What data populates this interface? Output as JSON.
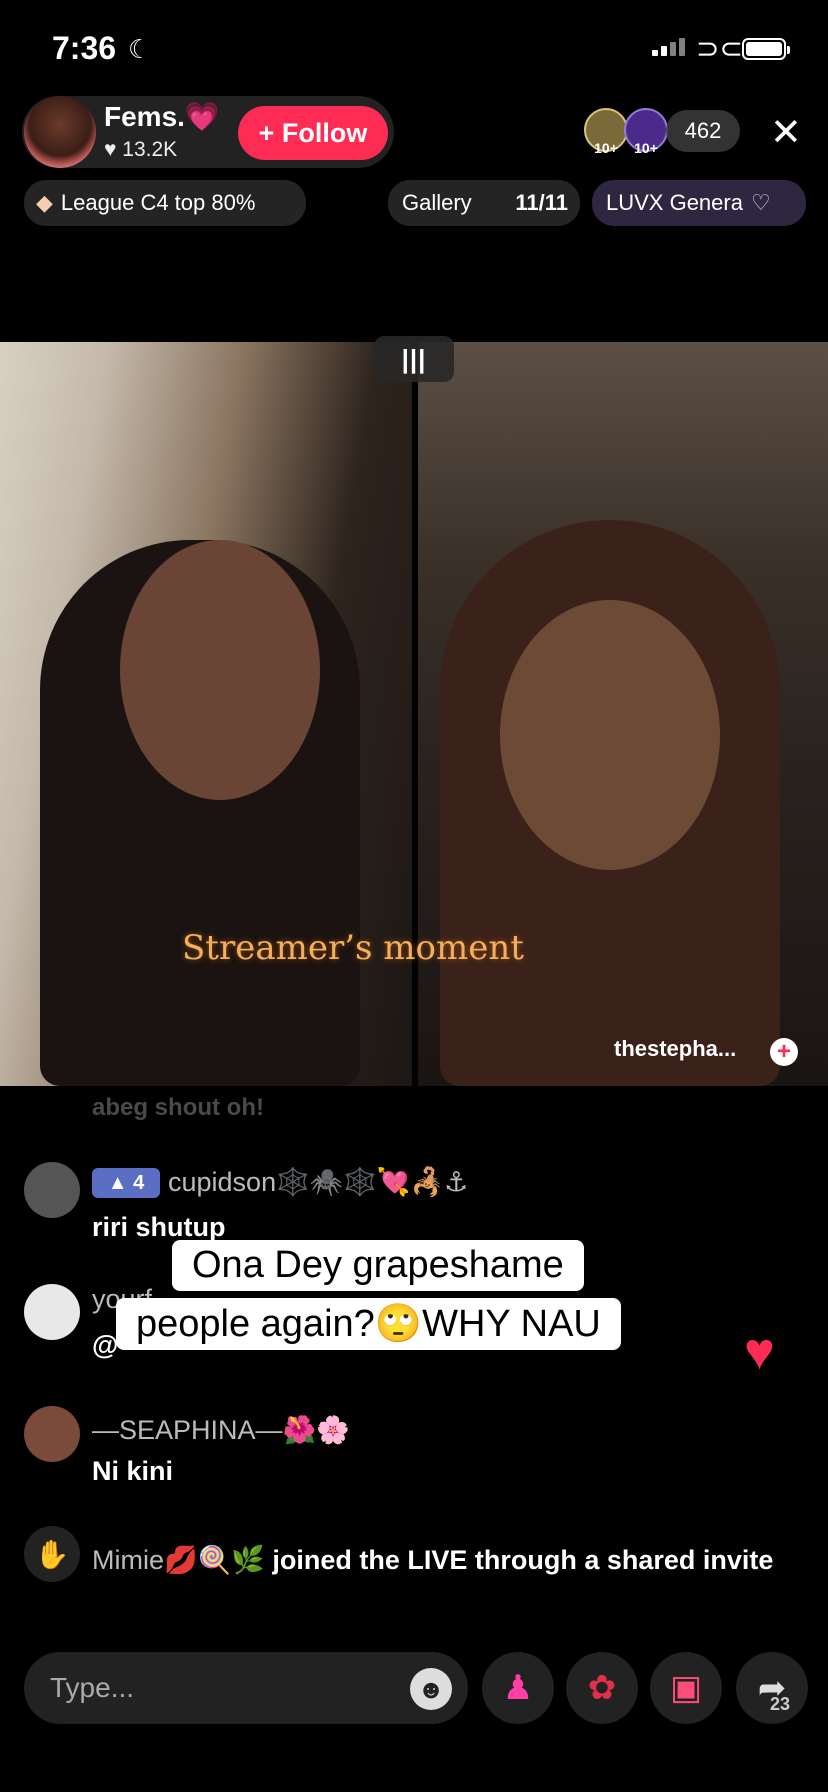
{
  "status_bar": {
    "time": "7:36"
  },
  "host": {
    "name": "Fems.💗",
    "likes": "♥ 13.2K",
    "follow_label": "+ Follow"
  },
  "viewers": {
    "badge1": "10+",
    "badge2": "10+",
    "count": "462"
  },
  "pills": {
    "league": "League C4 top 80%",
    "gallery_label": "Gallery",
    "gallery_count": "11/11",
    "luvx": "LUVX Genera"
  },
  "video": {
    "split_handle": "|||",
    "streamer_moment": "Streamer’s moment",
    "guest_name": "thestepha...",
    "guest_plus": "+"
  },
  "comments": {
    "faded_text": "abeg shout oh!",
    "items": [
      {
        "level": "4",
        "name": "cupidson🕸️🕷️🕸️💘🦂⚓",
        "text": "riri shutup"
      },
      {
        "name": "yourf",
        "text": "@"
      },
      {
        "name": "—SEAPHINA—🌺🌸",
        "text": "Ni kini"
      }
    ],
    "join": {
      "name": "Mimie💋🍭🌿",
      "text": " joined the LIVE through a shared invite"
    }
  },
  "caption": {
    "line1": "Ona Dey grapeshame",
    "line2": "people again?🙄WHY NAU"
  },
  "bottom_bar": {
    "input_placeholder": "Type...",
    "share_count": "23"
  },
  "icons": {
    "moon": "moon-icon",
    "close": "close-icon",
    "diamond": "diamond-icon",
    "heart": "heart-icon",
    "wave": "wave-icon",
    "emoji": "emoji-icon",
    "cohost": "cohost-icon",
    "rose": "rose-icon",
    "gift": "gift-icon",
    "share": "share-icon"
  },
  "colors": {
    "accent": "#fe2c55",
    "background": "#000000",
    "level_badge": "#5a6fc4"
  }
}
